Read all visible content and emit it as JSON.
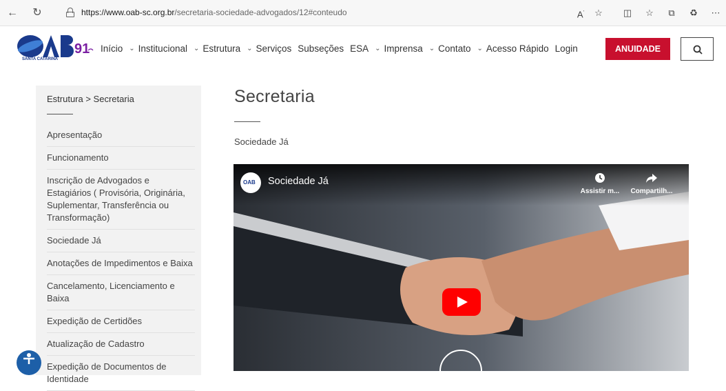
{
  "browser": {
    "url_host": "https://www.oab-sc.org.br",
    "url_path": "/secretaria-sociedade-advogados/12#conteudo",
    "icons": [
      "back-arrow-icon",
      "refresh-icon",
      "lock-icon",
      "read-aloud-icon",
      "favorite-star-icon",
      "split-screen-icon",
      "favorites-list-icon",
      "collections-icon",
      "extensions-icon",
      "more-icon"
    ]
  },
  "header": {
    "logo_text": "OAB 91",
    "logo_sub": "SANTA CATARINA",
    "menu": [
      {
        "label": "Início",
        "has_dropdown": false
      },
      {
        "label": "Institucional",
        "has_dropdown": true
      },
      {
        "label": "Estrutura",
        "has_dropdown": true
      },
      {
        "label": "Serviços",
        "has_dropdown": true
      },
      {
        "label": "Subseções",
        "has_dropdown": false
      },
      {
        "label": "ESA",
        "has_dropdown": false
      },
      {
        "label": "Imprensa",
        "has_dropdown": true
      },
      {
        "label": "Contato",
        "has_dropdown": true
      },
      {
        "label": "Acesso Rápido",
        "has_dropdown": true
      },
      {
        "label": "Login",
        "has_dropdown": false
      }
    ],
    "cta_label": "ANUIDADE",
    "colors": {
      "cta": "#c8102e",
      "brand_blue": "#1a3a8c"
    }
  },
  "sidebar": {
    "breadcrumb": "Estrutura > Secretaria",
    "items": [
      "Apresentação",
      "Funcionamento",
      "Inscrição de Advogados e Estagiários ( Provisória, Originária, Suplementar, Transferência ou Transformação)",
      "Sociedade Já",
      "Anotações de Impedimentos e Baixa",
      "Cancelamento, Licenciamento e Baixa",
      "Expedição de Certidões",
      "Atualização de Cadastro",
      "Expedição de Documentos de Identidade"
    ]
  },
  "main": {
    "title": "Secretaria",
    "subtitle": "Sociedade Já",
    "video": {
      "title": "Sociedade Já",
      "watch_later_label": "Assistir m...",
      "share_label": "Compartilh...",
      "channel_avatar_text": "OAB"
    }
  }
}
